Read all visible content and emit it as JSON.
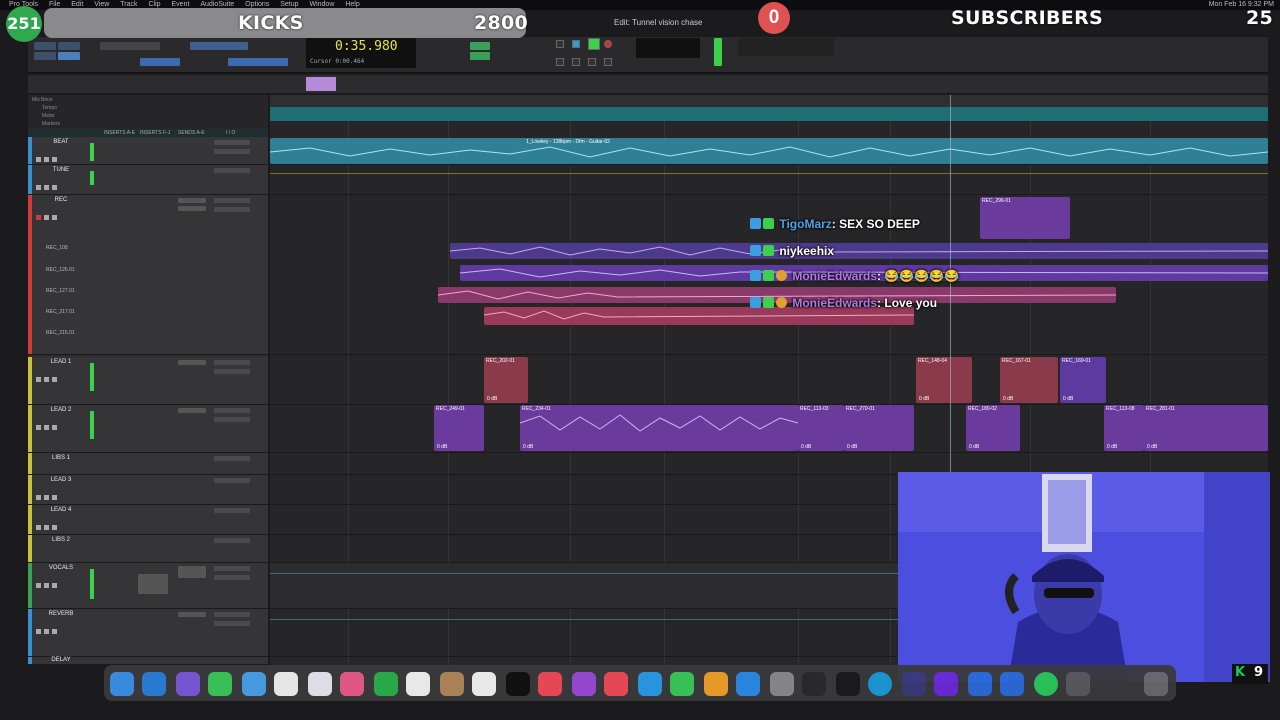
{
  "menubar": {
    "app": "Pro Tools",
    "items": [
      "File",
      "Edit",
      "View",
      "Track",
      "Clip",
      "Event",
      "AudioSuite",
      "Options",
      "Setup",
      "Window",
      "Help"
    ],
    "clock": "Mon Feb 16 9:32 PM"
  },
  "overlay": {
    "left_count": "251",
    "kicks_label": "KICKS",
    "kicks_value": "2800",
    "center_count": "0",
    "subscribers_label": "SUBSCRIBERS",
    "subscribers_value": "25"
  },
  "transport": {
    "window_title": "Edit: Tunnel vision chase",
    "counter_main": "0:35.980",
    "counter_sub": "Cursor",
    "counter_readout": "0:00.464"
  },
  "tracklist": {
    "header_rows": [
      "Mix Bnce",
      "Tempo",
      "Meter",
      "Markers"
    ],
    "columns": [
      "INSERTS A-E",
      "INSERTS F-J",
      "SENDS A-E",
      "I / O"
    ],
    "tracks": [
      {
        "name": "BEAT",
        "color": "#3a8fd0"
      },
      {
        "name": "TUNE",
        "color": "#3a8fd0"
      },
      {
        "name": "REC",
        "color": "#d23a3a",
        "playlists": [
          "REC_108",
          "REC_126.01",
          "REC_127.01",
          "REC_217.01",
          "REC_215.01"
        ]
      },
      {
        "name": "LEAD 1",
        "color": "#c7c23a"
      },
      {
        "name": "LEAD 2",
        "color": "#c7c23a"
      },
      {
        "name": "LIBS 1",
        "color": "#c7c23a"
      },
      {
        "name": "LEAD 3",
        "color": "#c7c23a"
      },
      {
        "name": "LEAD 4",
        "color": "#c7c23a"
      },
      {
        "name": "LIBS 2",
        "color": "#c7c23a"
      },
      {
        "name": "VOCALS",
        "color": "#3aa05a"
      },
      {
        "name": "REVERB",
        "color": "#3a8fd0"
      },
      {
        "name": "DELAY",
        "color": "#3a8fd0"
      }
    ]
  },
  "clips": {
    "beat": "1_Lowkey - 138bpm - Dfm - Guitar-02",
    "rec_top": "REC_296-01",
    "lead1": [
      "REC_202-01",
      "REC_148-04",
      "REC_167-01",
      "REC_169-01"
    ],
    "lead2": [
      "REC_249-01",
      "REC_234-01",
      "REC_113-03",
      "REC_270-01",
      "REC_180-02",
      "REC_113-08",
      "REC_281-01"
    ],
    "db": "0 dB"
  },
  "chat": [
    {
      "user": "TigoMarz",
      "message": ": SEX SO DEEP"
    },
    {
      "user": "niykeehix",
      "message": ""
    },
    {
      "user": "MonieEdwards",
      "message": ": 😂😂😂😂😂"
    },
    {
      "user": "MonieEdwards",
      "message": ": Love you"
    }
  ],
  "bottom_right": {
    "value": "9"
  },
  "colors": {
    "accent_green": "#2fa84f",
    "badge_red": "#e05252",
    "clip_purple": "#6a3a9c",
    "clip_pink": "#8a3a6a",
    "beat_blue": "#2f7f95",
    "cam_blue": "#4c4ee0"
  }
}
